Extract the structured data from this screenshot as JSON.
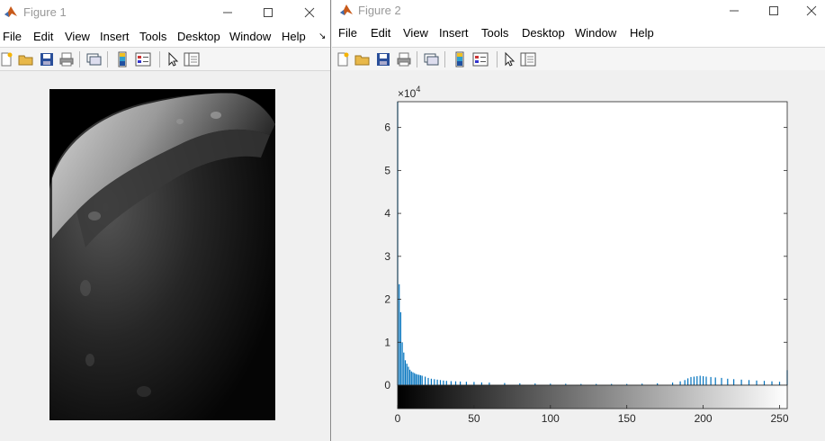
{
  "figure1": {
    "title": "Figure 1",
    "menus": [
      "File",
      "Edit",
      "View",
      "Insert",
      "Tools",
      "Desktop",
      "Window",
      "Help"
    ]
  },
  "figure2": {
    "title": "Figure 2",
    "menus": [
      "File",
      "Edit",
      "View",
      "Insert",
      "Tools",
      "Desktop",
      "Window",
      "Help"
    ]
  },
  "colors": {
    "bar": "#0072bd",
    "window_bg": "#f0f0f0"
  },
  "chart_data": {
    "type": "bar",
    "title": "",
    "xlabel": "",
    "ylabel": "",
    "xlim": [
      0,
      255
    ],
    "ylim": [
      0,
      66000
    ],
    "y_exponent_label": "×10",
    "y_exponent": "4",
    "yticks": [
      0,
      1,
      2,
      3,
      4,
      5,
      6
    ],
    "xticks": [
      0,
      50,
      100,
      150,
      200,
      250
    ],
    "x": [
      0,
      1,
      2,
      3,
      4,
      5,
      6,
      7,
      8,
      9,
      10,
      11,
      12,
      13,
      14,
      15,
      16,
      18,
      20,
      22,
      24,
      26,
      28,
      30,
      32,
      35,
      38,
      41,
      45,
      50,
      55,
      60,
      70,
      80,
      90,
      100,
      110,
      120,
      130,
      140,
      150,
      160,
      170,
      180,
      185,
      188,
      190,
      192,
      194,
      196,
      198,
      200,
      202,
      205,
      208,
      212,
      216,
      220,
      225,
      230,
      235,
      240,
      245,
      250,
      255
    ],
    "values": [
      66000,
      23500,
      17000,
      10000,
      7600,
      5800,
      5000,
      4300,
      3600,
      3200,
      3000,
      2800,
      2600,
      2500,
      2400,
      2300,
      2200,
      2000,
      1700,
      1500,
      1400,
      1300,
      1200,
      1100,
      1000,
      950,
      900,
      850,
      800,
      750,
      650,
      600,
      500,
      450,
      400,
      350,
      330,
      300,
      300,
      300,
      300,
      350,
      450,
      600,
      900,
      1200,
      1600,
      1900,
      2000,
      2100,
      2200,
      2100,
      2000,
      1900,
      1800,
      1700,
      1500,
      1400,
      1300,
      1200,
      1100,
      1000,
      900,
      800,
      3500
    ]
  }
}
